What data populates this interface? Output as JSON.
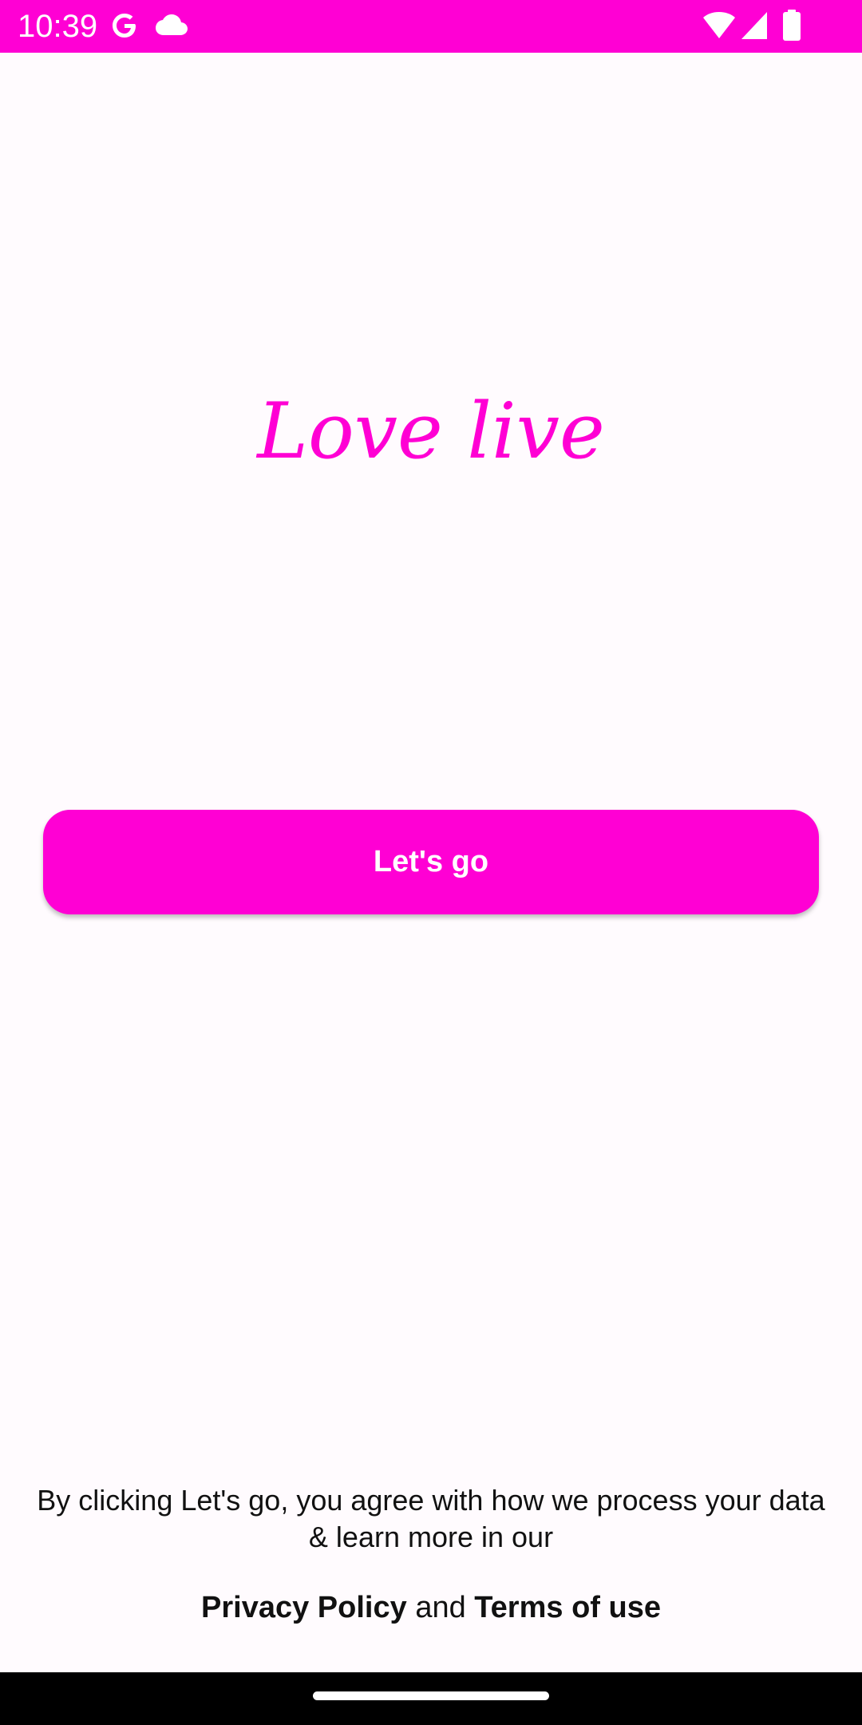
{
  "status_bar": {
    "time": "10:39",
    "left_icons": [
      "google-icon",
      "cloud-icon"
    ],
    "right_icons": [
      "wifi-icon",
      "signal-icon",
      "battery-icon"
    ],
    "background_color": "#ff00d4"
  },
  "app": {
    "title": "Love live",
    "accent_color": "#ff00d4"
  },
  "main": {
    "primary_button_label": "Let's go"
  },
  "footer": {
    "consent_text": "By clicking Let's go, you agree with how we process your data & learn more in our",
    "privacy_policy_label": "Privacy Policy",
    "conjunction": "and",
    "terms_label": "Terms of use"
  },
  "navigation": {
    "home_indicator": "home-handle"
  }
}
